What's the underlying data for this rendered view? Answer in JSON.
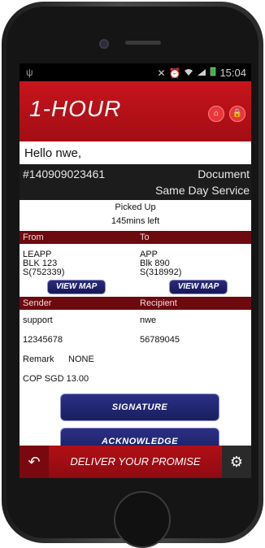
{
  "status_bar": {
    "usb_icon": "ψ",
    "icons": [
      "✕",
      "⏰",
      "wifi",
      "signal",
      "battery"
    ],
    "time": "15:04"
  },
  "header": {
    "title": "1-HOUR",
    "home_icon": "home-icon",
    "lock_icon": "lock-icon"
  },
  "greeting": "Hello nwe,",
  "order": {
    "id": "#140909023461",
    "type": "Document",
    "service": "Same Day Service",
    "status": "Picked Up",
    "time_left": "145mins left"
  },
  "from_to": {
    "from_label": "From",
    "to_label": "To",
    "from_name": "LEAPP",
    "from_line2": "BLK 123",
    "from_postal": "S(752339)",
    "to_name": "APP",
    "to_line2": "Blk 890",
    "to_postal": "S(318992)",
    "view_map": "VIEW MAP"
  },
  "parties": {
    "sender_label": "Sender",
    "recipient_label": "Recipient",
    "sender_name": "support",
    "sender_phone": "12345678",
    "recipient_name": "nwe",
    "recipient_phone": "56789045",
    "remark_label": "Remark",
    "remark_value": "NONE",
    "cop": "COP SGD 13.00"
  },
  "actions": {
    "signature": "SIGNATURE",
    "acknowledge": "ACKNOWLEDGE"
  },
  "footer": {
    "slogan": "DELIVER YOUR PROMISE",
    "back_icon": "back-arrow-icon",
    "settings_icon": "gear-icon"
  },
  "colors": {
    "brand_red": "#c8141c",
    "section_dark_red": "#6c0a10",
    "button_navy": "#1a1f5e"
  }
}
